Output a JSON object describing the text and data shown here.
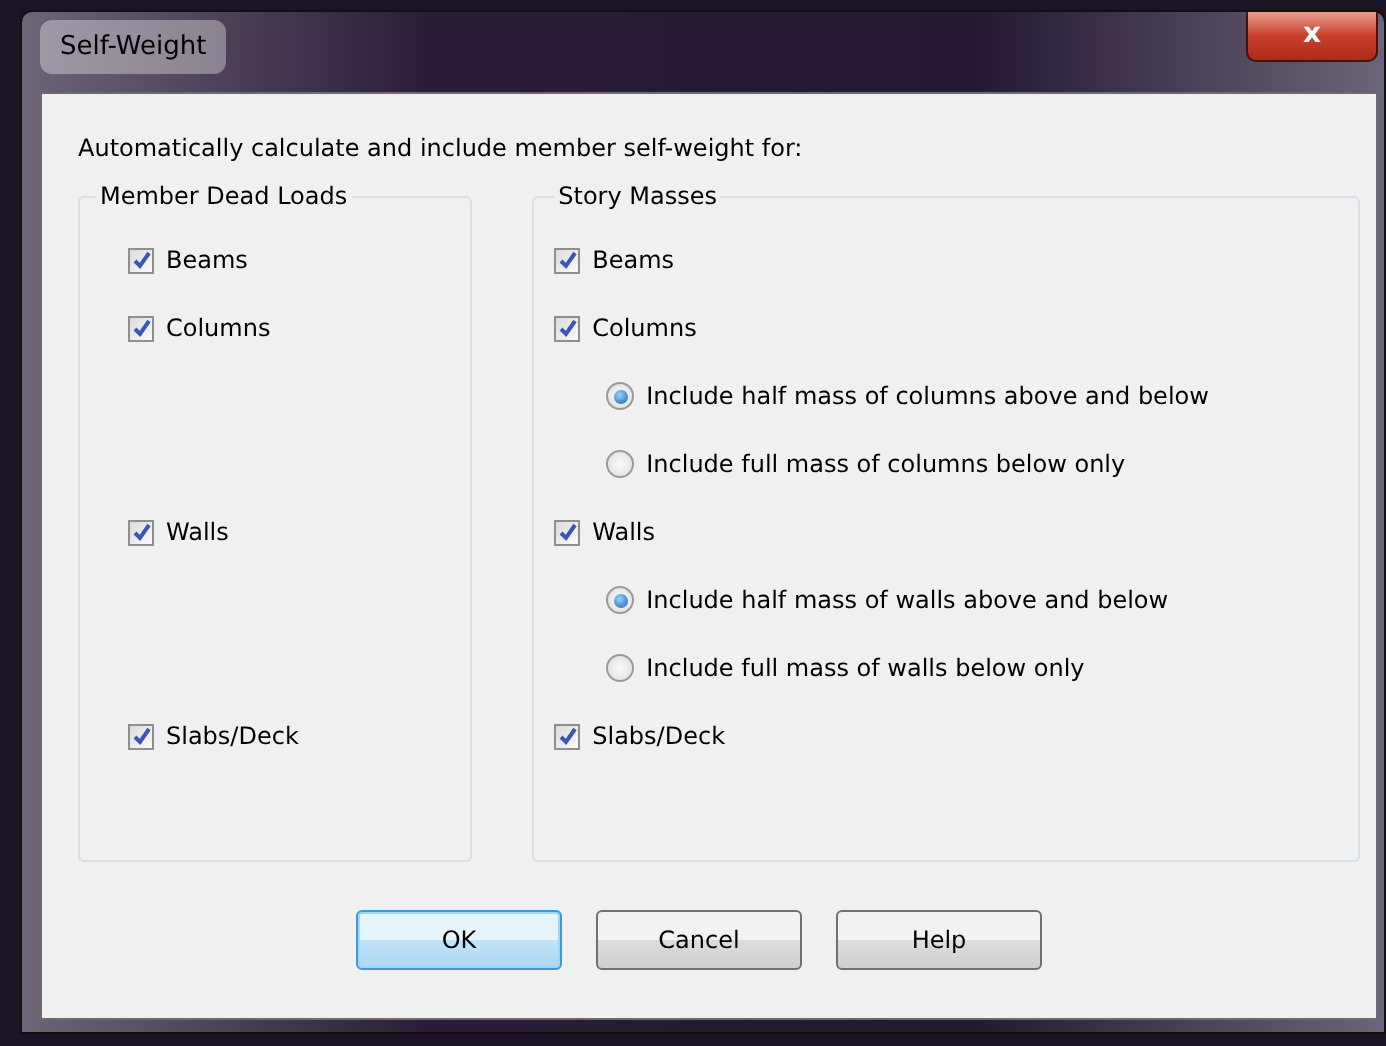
{
  "window": {
    "title": "Self-Weight",
    "close_label": "x"
  },
  "intro": "Automatically calculate and include member self-weight for:",
  "member_dead_loads": {
    "title": "Member Dead Loads",
    "items": [
      {
        "label": "Beams",
        "checked": true
      },
      {
        "label": "Columns",
        "checked": true
      },
      {
        "label": "Walls",
        "checked": true
      },
      {
        "label": "Slabs/Deck",
        "checked": true
      }
    ]
  },
  "story_masses": {
    "title": "Story Masses",
    "items": [
      {
        "label": "Beams",
        "checked": true
      },
      {
        "label": "Columns",
        "checked": true,
        "options": [
          {
            "label": "Include half mass of columns above and below",
            "selected": true
          },
          {
            "label": "Include full mass of columns below only",
            "selected": false
          }
        ]
      },
      {
        "label": "Walls",
        "checked": true,
        "options": [
          {
            "label": "Include half mass of walls above and below",
            "selected": true
          },
          {
            "label": "Include full mass of walls below only",
            "selected": false
          }
        ]
      },
      {
        "label": "Slabs/Deck",
        "checked": true
      }
    ]
  },
  "buttons": [
    {
      "label": "OK",
      "default": true
    },
    {
      "label": "Cancel",
      "default": false
    },
    {
      "label": "Help",
      "default": false
    }
  ]
}
